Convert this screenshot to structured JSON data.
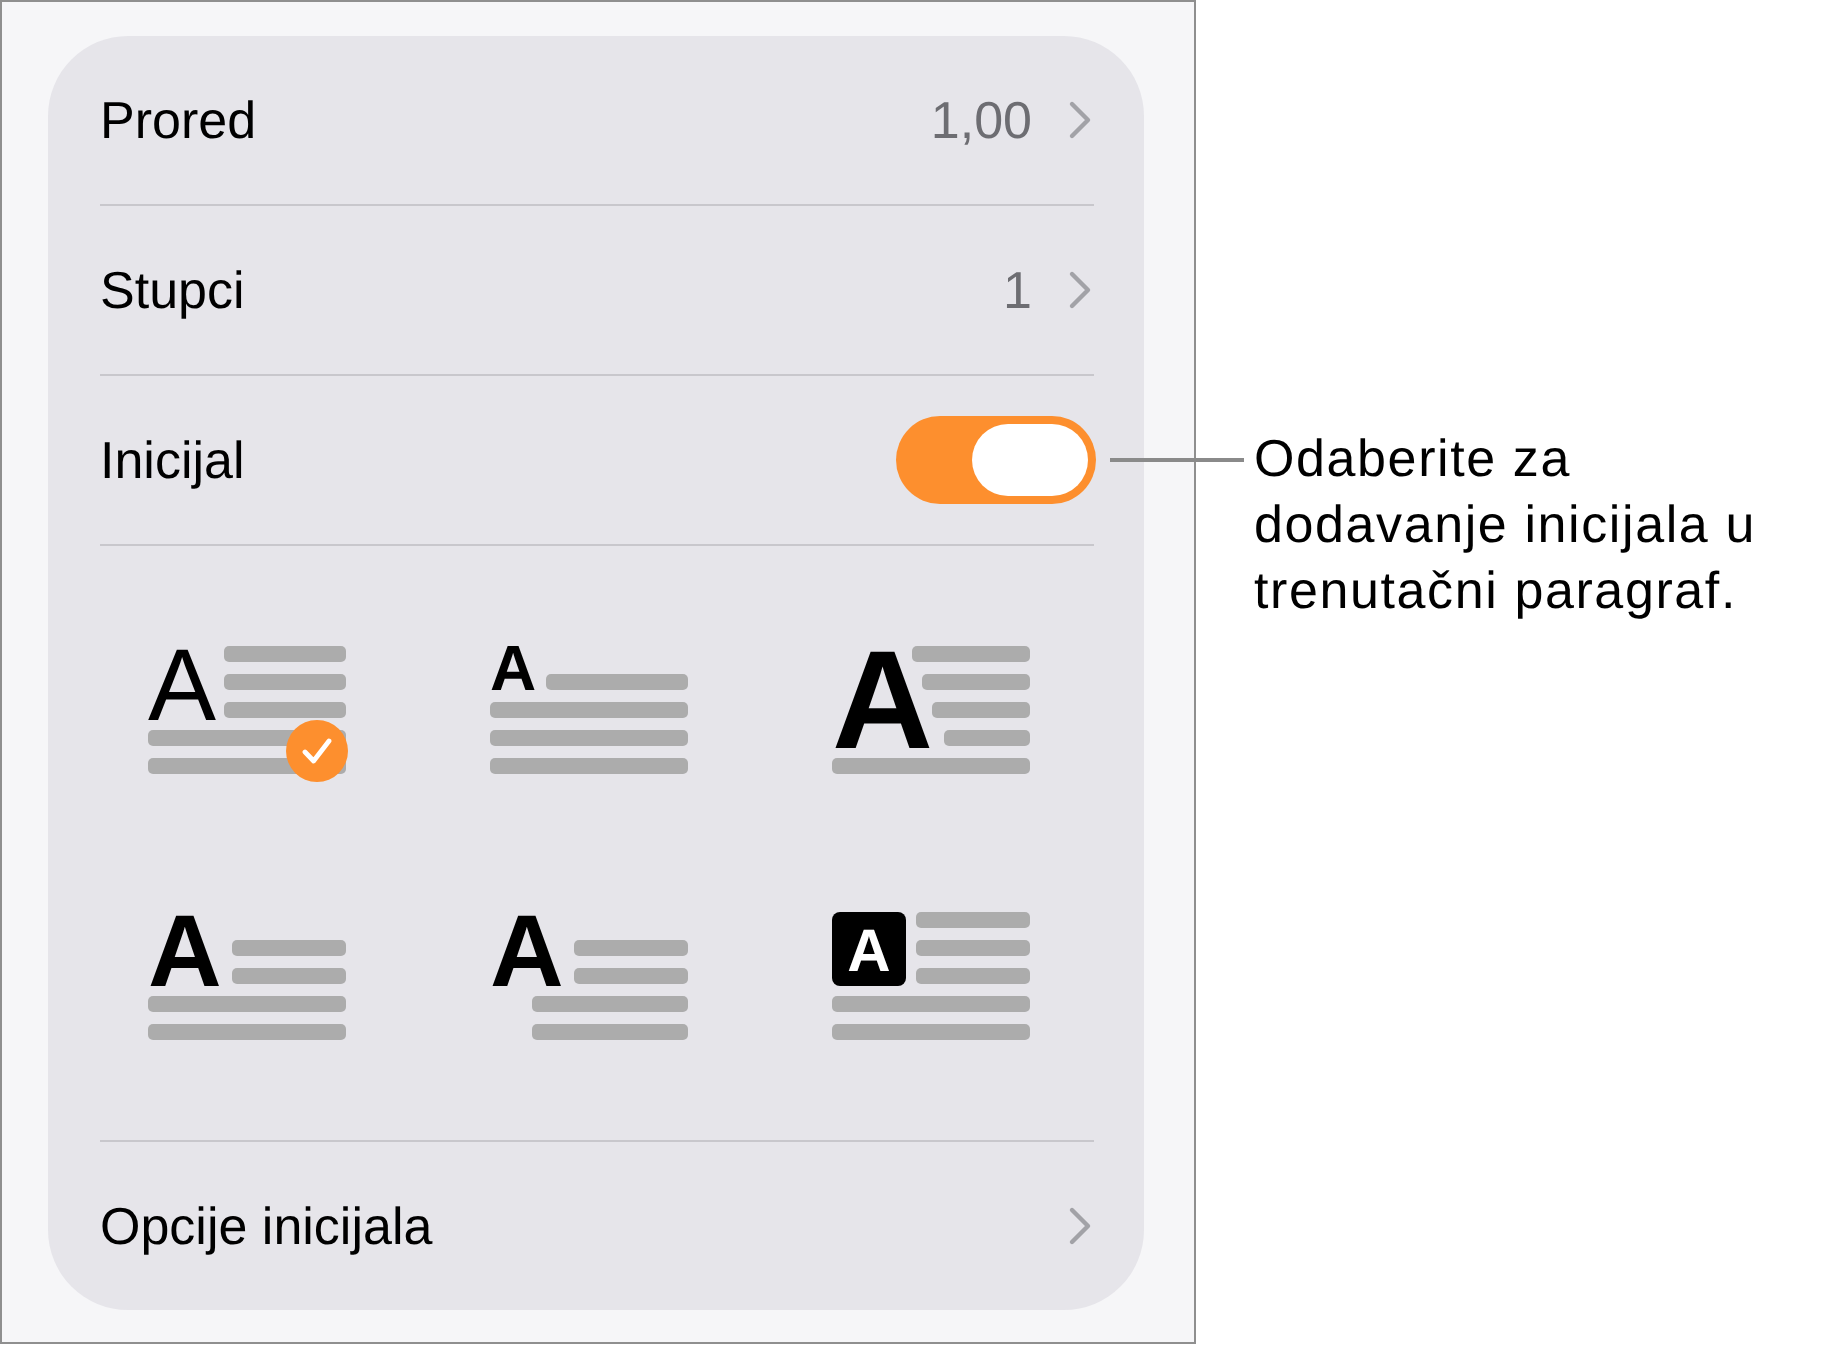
{
  "panel": {
    "rows": [
      {
        "kind": "value",
        "label": "Prored",
        "value": "1,00"
      },
      {
        "kind": "value",
        "label": "Stupci",
        "value": "1"
      },
      {
        "kind": "toggle",
        "label": "Inicijal",
        "on": true
      }
    ],
    "drop_cap_styles": [
      {
        "kind": "thin",
        "letter": "A",
        "selected": true
      },
      {
        "kind": "raised",
        "letter": "A",
        "selected": false
      },
      {
        "kind": "large",
        "letter": "A",
        "selected": false
      },
      {
        "kind": "bold",
        "letter": "A",
        "selected": false
      },
      {
        "kind": "margin",
        "letter": "A",
        "selected": false
      },
      {
        "kind": "boxed",
        "letter": "A",
        "selected": false
      }
    ],
    "options_row": {
      "label": "Opcije inicijala"
    }
  },
  "callout": {
    "text": "Odaberite za dodavanje inicijala u trenutačni paragraf."
  }
}
